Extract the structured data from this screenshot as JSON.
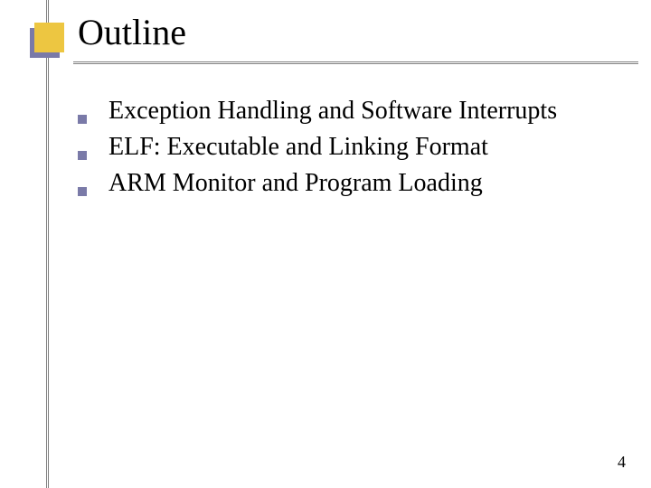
{
  "title": "Outline",
  "bullets": [
    "Exception Handling and Software Interrupts",
    "ELF: Executable and Linking Format",
    "ARM Monitor and Program Loading"
  ],
  "page_number": "4"
}
